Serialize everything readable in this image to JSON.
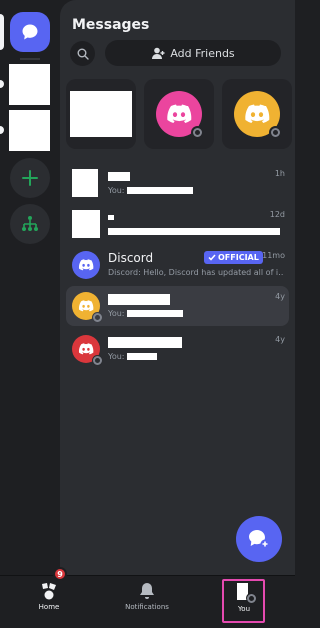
{
  "panel": {
    "title": "Messages",
    "add_friends_label": "Add Friends"
  },
  "friends_carousel": [
    {
      "type": "redacted"
    },
    {
      "type": "avatar",
      "color": "#eb459e",
      "status": "offline"
    },
    {
      "type": "avatar",
      "color": "#f0b232",
      "status": "offline"
    }
  ],
  "dms": [
    {
      "name": "",
      "preview_prefix": "You:",
      "time": "1h",
      "avatar": "redacted"
    },
    {
      "name": "",
      "preview_prefix": "",
      "time": "12d",
      "avatar": "redacted"
    },
    {
      "name": "Discord",
      "badge": "OFFICIAL",
      "preview": "Discord: Hello, Discord has updated all of i…",
      "time": "11mo",
      "avatar_color": "#5865f2"
    },
    {
      "name": "",
      "preview_prefix": "You:",
      "time": "4y",
      "avatar_color": "#f0b232",
      "active": true
    },
    {
      "name": "",
      "preview_prefix": "You:",
      "time": "4y",
      "avatar_color": "#da373c"
    }
  ],
  "bottom_nav": {
    "home_label": "Home",
    "home_badge": "9",
    "notifications_label": "Notifications",
    "you_label": "You"
  },
  "colors": {
    "brand": "#5865f2",
    "highlight": "#e54ab0",
    "green": "#23a55a"
  }
}
